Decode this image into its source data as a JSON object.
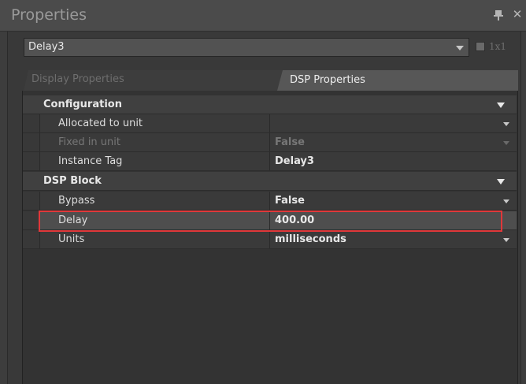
{
  "window": {
    "title": "Properties",
    "pin_icon": "pin-icon",
    "close_icon": "close-icon",
    "close_glyph": "✕"
  },
  "selector": {
    "value": "Delay3",
    "grid_label": "1x1"
  },
  "tabs": [
    {
      "label": "Display Properties",
      "active": false
    },
    {
      "label": "DSP Properties",
      "active": true
    }
  ],
  "categories": [
    {
      "label": "Configuration",
      "properties": [
        {
          "name": "Allocated to unit",
          "value": "",
          "dropdown": true,
          "disabled": false
        },
        {
          "name": "Fixed in unit",
          "value": "False",
          "dropdown": true,
          "disabled": true
        },
        {
          "name": "Instance Tag",
          "value": "Delay3",
          "dropdown": false,
          "disabled": false
        }
      ]
    },
    {
      "label": "DSP Block",
      "properties": [
        {
          "name": "Bypass",
          "value": "False",
          "dropdown": true,
          "disabled": false
        },
        {
          "name": "Delay",
          "value": "400.00",
          "dropdown": false,
          "disabled": false,
          "highlighted": true
        },
        {
          "name": "Units",
          "value": "milliseconds",
          "dropdown": true,
          "disabled": false
        }
      ]
    }
  ],
  "colors": {
    "highlight_border": "#e0383a",
    "background": "#3d3d3d"
  }
}
